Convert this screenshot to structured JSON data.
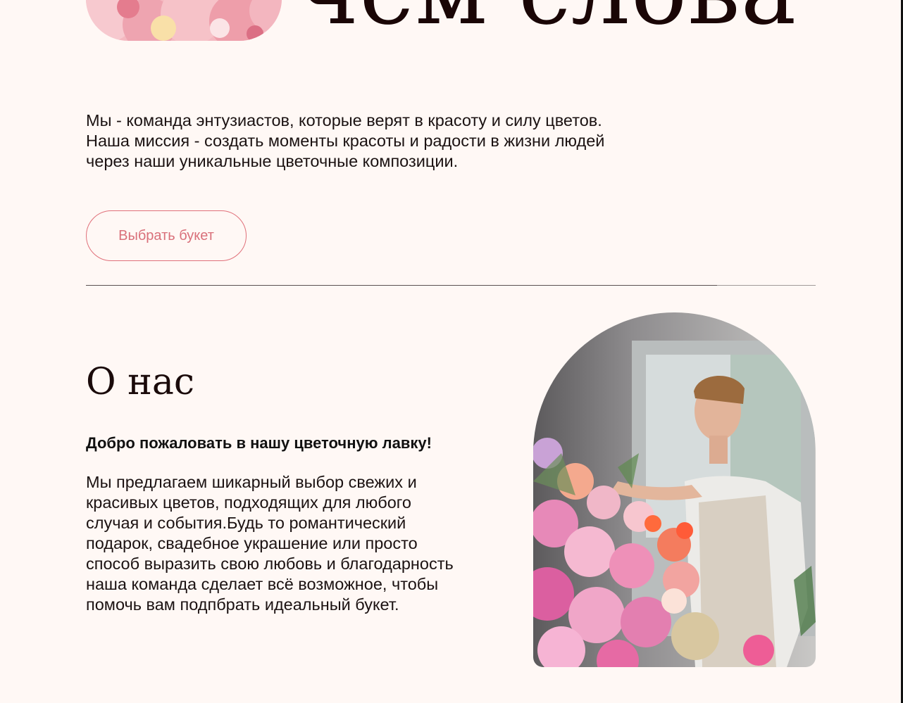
{
  "hero": {
    "title": "чем слова",
    "description": "Мы - команда энтузиастов, которые верят в красоту и силу цветов. Наша миссия - создать моменты красоты и радости в жизни людей через наши уникальные цветочные композиции.",
    "cta_label": "Выбрать букет"
  },
  "about": {
    "title": "О нас",
    "subtitle": "Добро пожаловать в нашу цветочную лавку!",
    "text": "Мы предлагаем шикарный выбор свежих и красивых цветов, подходящих для любого случая и события.Будь то романтический подарок, свадебное украшение или просто способ выразить свою любовь и благодарность наша команда сделает всё возможное, чтобы помочь вам подпбрать идеальный букет."
  },
  "colors": {
    "background": "#fff8f5",
    "accent": "#d9707a",
    "text": "#1a0a0a"
  }
}
